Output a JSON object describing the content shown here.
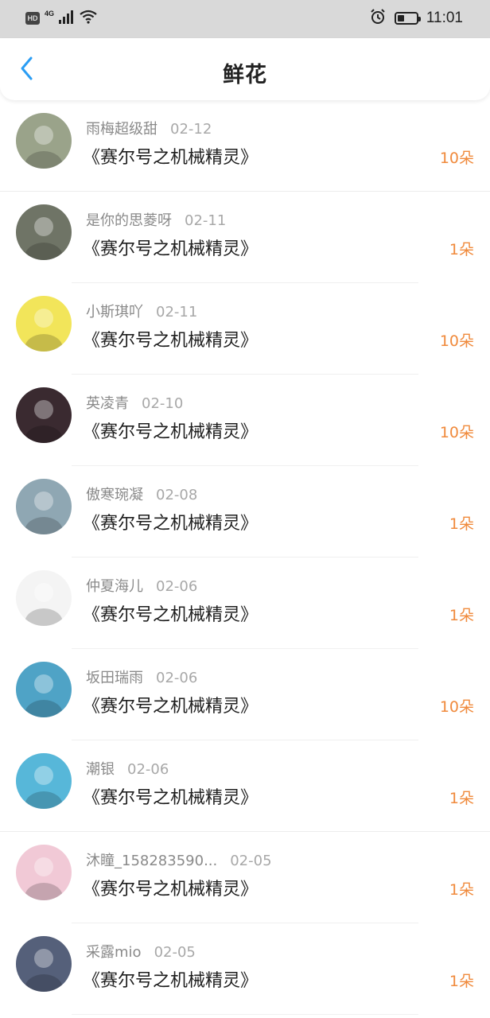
{
  "status_bar": {
    "hd": "HD",
    "network": "4G",
    "time": "11:01",
    "battery_level": 0.35,
    "icons": [
      "signal-icon",
      "wifi-icon",
      "alarm-icon",
      "battery-icon"
    ]
  },
  "header": {
    "back_icon": "chevron-left-icon",
    "title": "鲜花"
  },
  "colors": {
    "accent_blue": "#2a9df4",
    "count_orange": "#f08a3c"
  },
  "items": [
    {
      "name": "雨梅超级甜",
      "date": "02-12",
      "book": "《赛尔号之机械精灵》",
      "count": "10朵",
      "avatar_color": "#9aa38a"
    },
    {
      "name": "是你的思菱呀",
      "date": "02-11",
      "book": "《赛尔号之机械精灵》",
      "count": "1朵",
      "avatar_color": "#6f7466"
    },
    {
      "name": "小斯琪吖",
      "date": "02-11",
      "book": "《赛尔号之机械精灵》",
      "count": "10朵",
      "avatar_color": "#f2e55a"
    },
    {
      "name": "英凌青",
      "date": "02-10",
      "book": "《赛尔号之机械精灵》",
      "count": "10朵",
      "avatar_color": "#3a2a30"
    },
    {
      "name": "傲寒琬凝",
      "date": "02-08",
      "book": "《赛尔号之机械精灵》",
      "count": "1朵",
      "avatar_color": "#8fa7b3"
    },
    {
      "name": "仲夏海儿",
      "date": "02-06",
      "book": "《赛尔号之机械精灵》",
      "count": "1朵",
      "avatar_color": "#f4f4f4"
    },
    {
      "name": "坂田瑞雨",
      "date": "02-06",
      "book": "《赛尔号之机械精灵》",
      "count": "10朵",
      "avatar_color": "#4fa3c6"
    },
    {
      "name": "潮银",
      "date": "02-06",
      "book": "《赛尔号之机械精灵》",
      "count": "1朵",
      "avatar_color": "#57b7d9"
    },
    {
      "name": "沐瞳_158283590...",
      "date": "02-05",
      "book": "《赛尔号之机械精灵》",
      "count": "1朵",
      "avatar_color": "#f1c9d6"
    },
    {
      "name": "采露mio",
      "date": "02-05",
      "book": "《赛尔号之机械精灵》",
      "count": "1朵",
      "avatar_color": "#55607a"
    }
  ]
}
